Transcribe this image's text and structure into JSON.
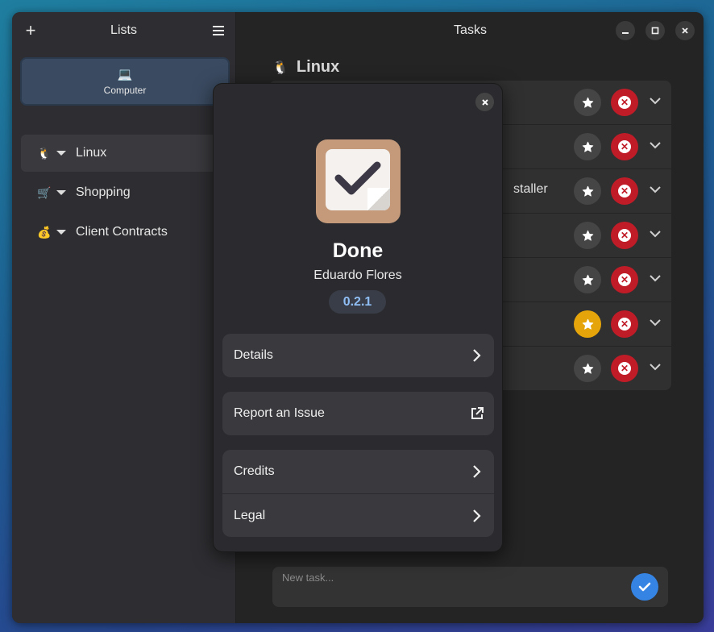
{
  "sidebar": {
    "title": "Lists",
    "source": {
      "icon": "laptop-icon",
      "label": "Computer"
    },
    "items": [
      {
        "emoji": "🐧",
        "label": "Linux"
      },
      {
        "emoji": "🛒",
        "label": "Shopping"
      },
      {
        "emoji": "💰",
        "label": "Client Contracts"
      }
    ]
  },
  "main": {
    "title": "Tasks",
    "list_emoji": "🐧",
    "list_name": "Linux",
    "partial_task_text": "staller",
    "tasks": [
      {
        "favorite": false
      },
      {
        "favorite": false
      },
      {
        "favorite": false
      },
      {
        "favorite": false
      },
      {
        "favorite": false
      },
      {
        "favorite": true
      },
      {
        "favorite": false
      }
    ],
    "new_task_placeholder": "New task..."
  },
  "about": {
    "app_name": "Done",
    "developer": "Eduardo Flores",
    "version": "0.2.1",
    "rows": {
      "details": "Details",
      "report": "Report an Issue",
      "credits": "Credits",
      "legal": "Legal"
    }
  },
  "colors": {
    "accent": "#3584e4",
    "favorite": "#e5a50a",
    "destructive": "#c01c28",
    "version_text": "#8fbef5"
  }
}
